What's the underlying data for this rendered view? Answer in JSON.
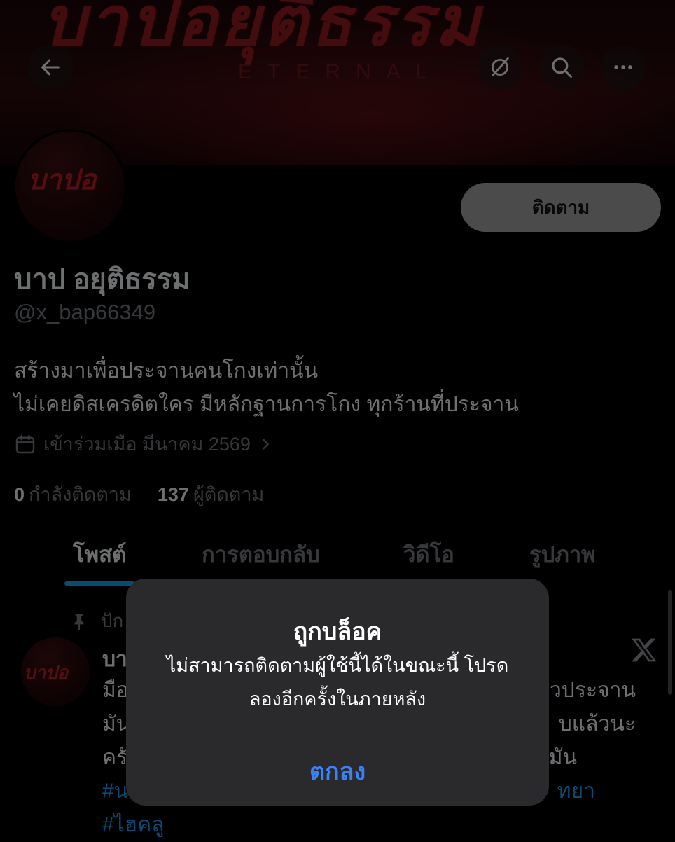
{
  "header": {
    "banner_logo_text": "บาปอยุติธรรม",
    "banner_subtitle": "ETERNAL",
    "icons": [
      "back-arrow-icon",
      "grok-icon",
      "search-icon",
      "more-icon"
    ]
  },
  "profile": {
    "display_name": "บาป อยุติธรรม",
    "handle": "@x_bap66349",
    "follow_label": "ติดตาม",
    "bio_line1": "สร้างมาเพื่อประจานคนโกงเท่านั้น",
    "bio_line2": "ไม่เคยดิสเครดิตใคร มีหลักฐานการโกง ทุกร้านที่ประจาน",
    "joined": "เข้าร่วมเมือ มีนาคม 2569",
    "following_count": "0",
    "following_label": "กำลังติดตาม",
    "followers_count": "137",
    "followers_label": "ผู้ติดตาม"
  },
  "tabs": [
    {
      "label": "โพสต์",
      "active": true
    },
    {
      "label": "การตอบกลับ",
      "active": false
    },
    {
      "label": "วิดีโอ",
      "active": false
    },
    {
      "label": "รูปภาพ",
      "active": false
    }
  ],
  "post": {
    "pinned_label": "ปัก",
    "author_fragment": "บา",
    "line1_left": "มือ",
    "line1_right": "วประจาน",
    "line2_left": "มัน",
    "line2_right": "บแล้วนะ",
    "line3_left": "ครั",
    "line3_right": "มัน",
    "line4_left": "#น",
    "line4_right": "ทยา",
    "hashtag": "#ไฮคลู"
  },
  "alert": {
    "title": "ถูกบล็อค",
    "message": "ไม่สามารถติดตามผู้ใช้นี้ได้ในขณะนี้ โปรดลองอีกครั้งในภายหลัง",
    "ok_label": "ตกลง"
  },
  "colors": {
    "background": "#000000",
    "text_primary": "#e7e9ea",
    "text_secondary": "#71767b",
    "accent": "#1d9bf0",
    "alert_bg": "#2a2a2c",
    "alert_button": "#3b82f6"
  }
}
